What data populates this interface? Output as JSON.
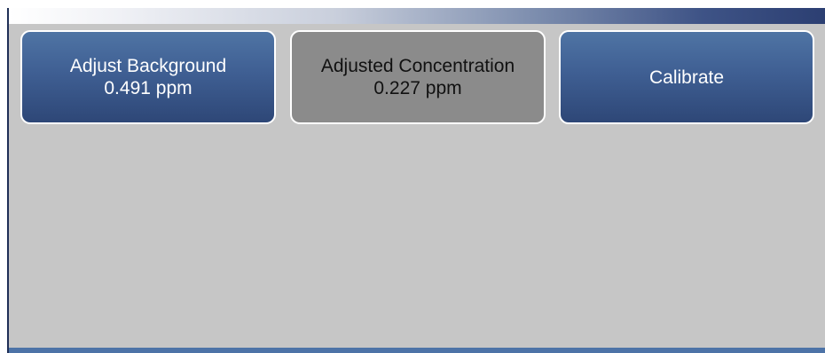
{
  "buttons": {
    "adjust_background": {
      "label": "Adjust Background",
      "value": "0.491 ppm"
    },
    "adjusted_concentration": {
      "label": "Adjusted Concentration",
      "value": "0.227 ppm"
    },
    "calibrate": {
      "label": "Calibrate"
    }
  },
  "colors": {
    "button_blue": "#3f5f93",
    "button_gray": "#8b8b8b",
    "background": "#c6c6c6",
    "bottom_bar": "#4d73a7"
  }
}
